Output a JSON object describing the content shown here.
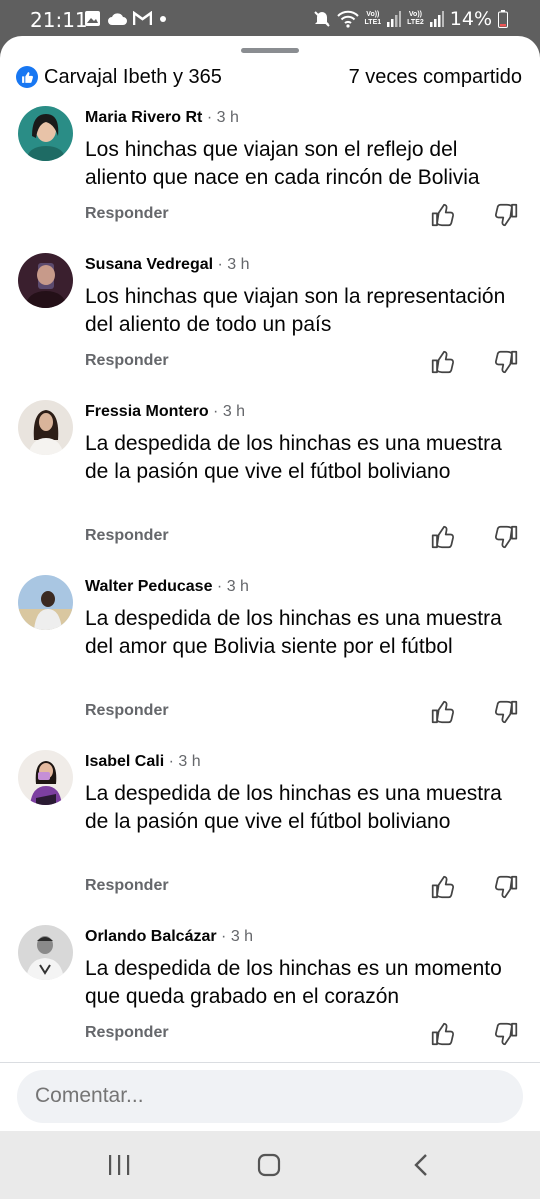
{
  "status_bar": {
    "time": "21:11",
    "battery": "14%",
    "sim1_label": "Vo)) LTE1",
    "sim2_label": "Vo)) LTE2",
    "icons": [
      "gallery-icon",
      "cloud-icon",
      "gmail-icon",
      "dot-icon",
      "mute-icon",
      "wifi-icon",
      "signal-icon",
      "battery-icon"
    ]
  },
  "header": {
    "reactions": "Carvajal Ibeth y 365",
    "shares": "7 veces compartido"
  },
  "colors": {
    "accent": "#1877f2",
    "text": "#050505",
    "secondary": "#65676b"
  },
  "comments": [
    {
      "author": "Maria Rivero Rt",
      "time": " · 3 h",
      "text": "Los hinchas que viajan son el reflejo del aliento que nace en cada rincón de Bolivia",
      "reply": "Responder"
    },
    {
      "author": "Susana Vedregal",
      "time": " · 3 h",
      "text": "Los hinchas que viajan son la representación del aliento de todo un país",
      "reply": "Responder"
    },
    {
      "author": "Fressia Montero",
      "time": " · 3 h",
      "text": "La despedida de los hinchas es una muestra de la pasión que vive el fútbol boliviano",
      "reply": "Responder"
    },
    {
      "author": "Walter Peducase",
      "time": " · 3 h",
      "text": "La despedida de los hinchas es una muestra del amor que Bolivia siente por el fútbol",
      "reply": "Responder"
    },
    {
      "author": "Isabel Cali",
      "time": " · 3 h",
      "text": "La despedida de los hinchas es una muestra de la pasión que vive el fútbol boliviano",
      "reply": "Responder"
    },
    {
      "author": "Orlando Balcázar",
      "time": " · 3 h",
      "text": "La despedida de los hinchas es un momento que queda grabado en el corazón",
      "reply": "Responder"
    }
  ],
  "composer": {
    "placeholder": "Comentar..."
  }
}
